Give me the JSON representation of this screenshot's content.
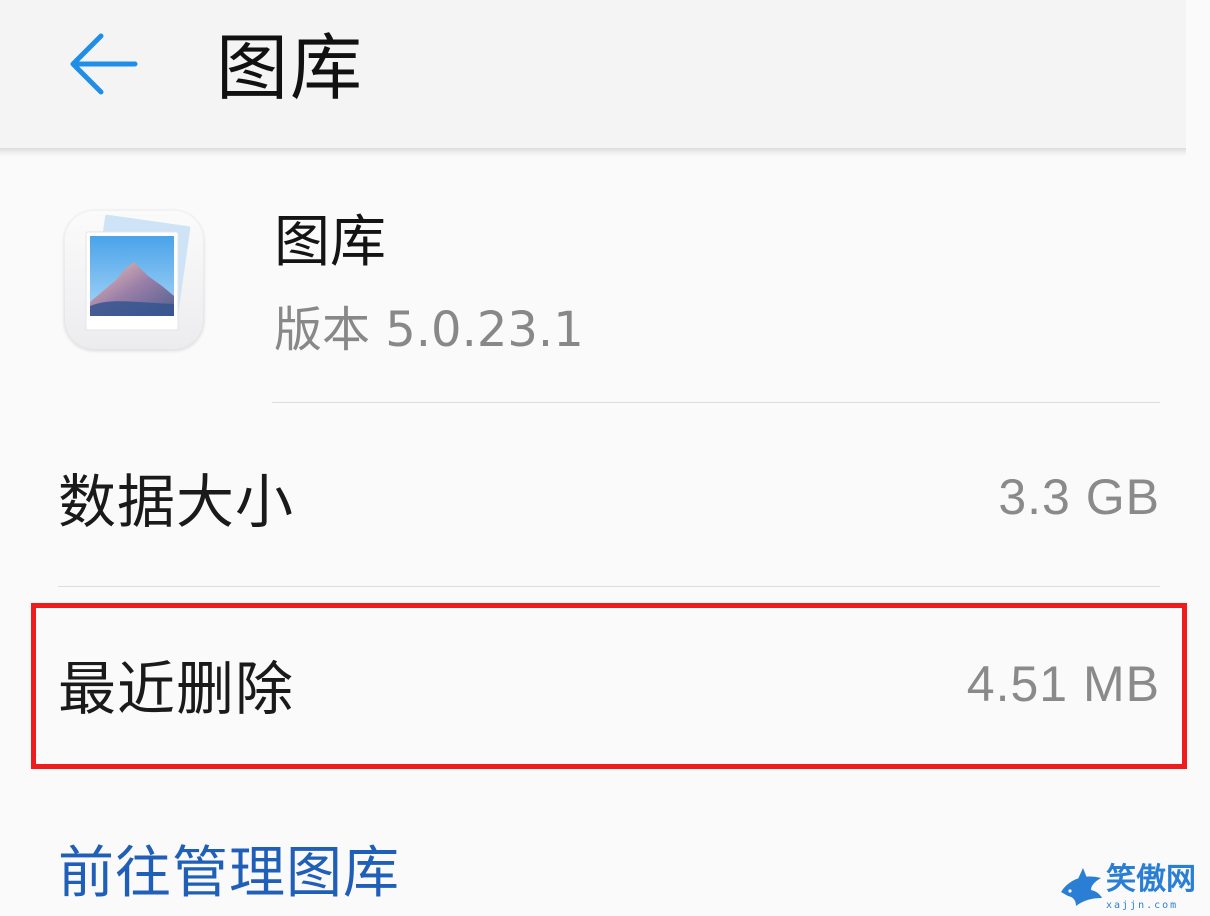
{
  "header": {
    "title": "图库"
  },
  "app": {
    "name": "图库",
    "version": "版本 5.0.23.1"
  },
  "rows": [
    {
      "label": "数据大小",
      "value": "3.3 GB"
    },
    {
      "label": "最近删除",
      "value": "4.51 MB"
    }
  ],
  "link": {
    "label": "前往管理图库"
  },
  "watermark": {
    "text": "笑傲网",
    "domain": "xajjn.com"
  },
  "colors": {
    "accent_link": "#1f5fb8",
    "back_arrow": "#1f8ee8",
    "highlight": "#ee1c1c"
  },
  "icons": {
    "back": "arrow-left-icon",
    "app": "gallery-app-icon",
    "watermark": "shark-logo-icon"
  }
}
